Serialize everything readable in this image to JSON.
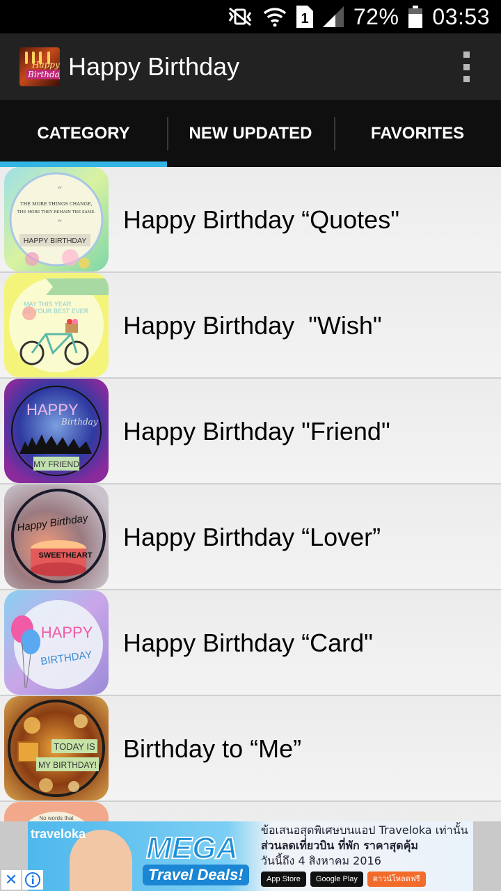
{
  "status_bar": {
    "battery": "72%",
    "time": "03:53",
    "icons": [
      "vibrate-mute-icon",
      "wifi-icon",
      "sim-1-icon",
      "signal-icon",
      "battery-icon"
    ]
  },
  "app_bar": {
    "title": "Happy Birthday",
    "icon_text_top": "Happy",
    "icon_text_bottom": "Birthday",
    "overflow_icon": "more-vert-icon"
  },
  "tabs": [
    {
      "label": "CATEGORY",
      "selected": true
    },
    {
      "label": "NEW UPDATED",
      "selected": false
    },
    {
      "label": "FAVORITES",
      "selected": false
    }
  ],
  "accent_color": "#33b5e5",
  "categories": [
    {
      "label": "Happy Birthday “Quotes\"",
      "thumb_text": [
        "THE MORE THINGS CHANGE,",
        "THE MORE THEY REMAIN THE SAME.",
        "HAPPY BIRTHDAY"
      ]
    },
    {
      "label": "Happy Birthday  \"Wish\"",
      "thumb_text": [
        "MAY THIS YEAR",
        "BE YOUR BEST EVER"
      ]
    },
    {
      "label": "Happy Birthday \"Friend\"",
      "thumb_text": [
        "HAPPY",
        "Birthday",
        "MY FRIEND"
      ]
    },
    {
      "label": "Happy Birthday “Lover”",
      "thumb_text": [
        "Happy Birthday",
        "SWEETHEART"
      ]
    },
    {
      "label": "Happy Birthday “Card\"",
      "thumb_text": [
        "HAPPY",
        "BIRTHDAY"
      ]
    },
    {
      "label": "Birthday to “Me”",
      "thumb_text": [
        "TODAY IS",
        "MY BIRTHDAY!"
      ]
    },
    {
      "label": "",
      "thumb_text": [
        "No words that"
      ]
    }
  ],
  "ad": {
    "brand": "traveloka",
    "headline": "MEGA",
    "subhead": "Travel Deals!",
    "thai_line1": "ข้อเสนอสุดพิเศษบนแอป Traveloka เท่านั้น",
    "thai_line2": "ส่วนลดเที่ยวบิน ที่พัก ราคาสุดคุ้ม",
    "thai_line3": "วันนี้ถึง 4 สิงหาคม 2016",
    "btn_appstore": "App Store",
    "btn_googleplay": "Google Play",
    "btn_download": "ดาวน์โหลดฟรี"
  }
}
